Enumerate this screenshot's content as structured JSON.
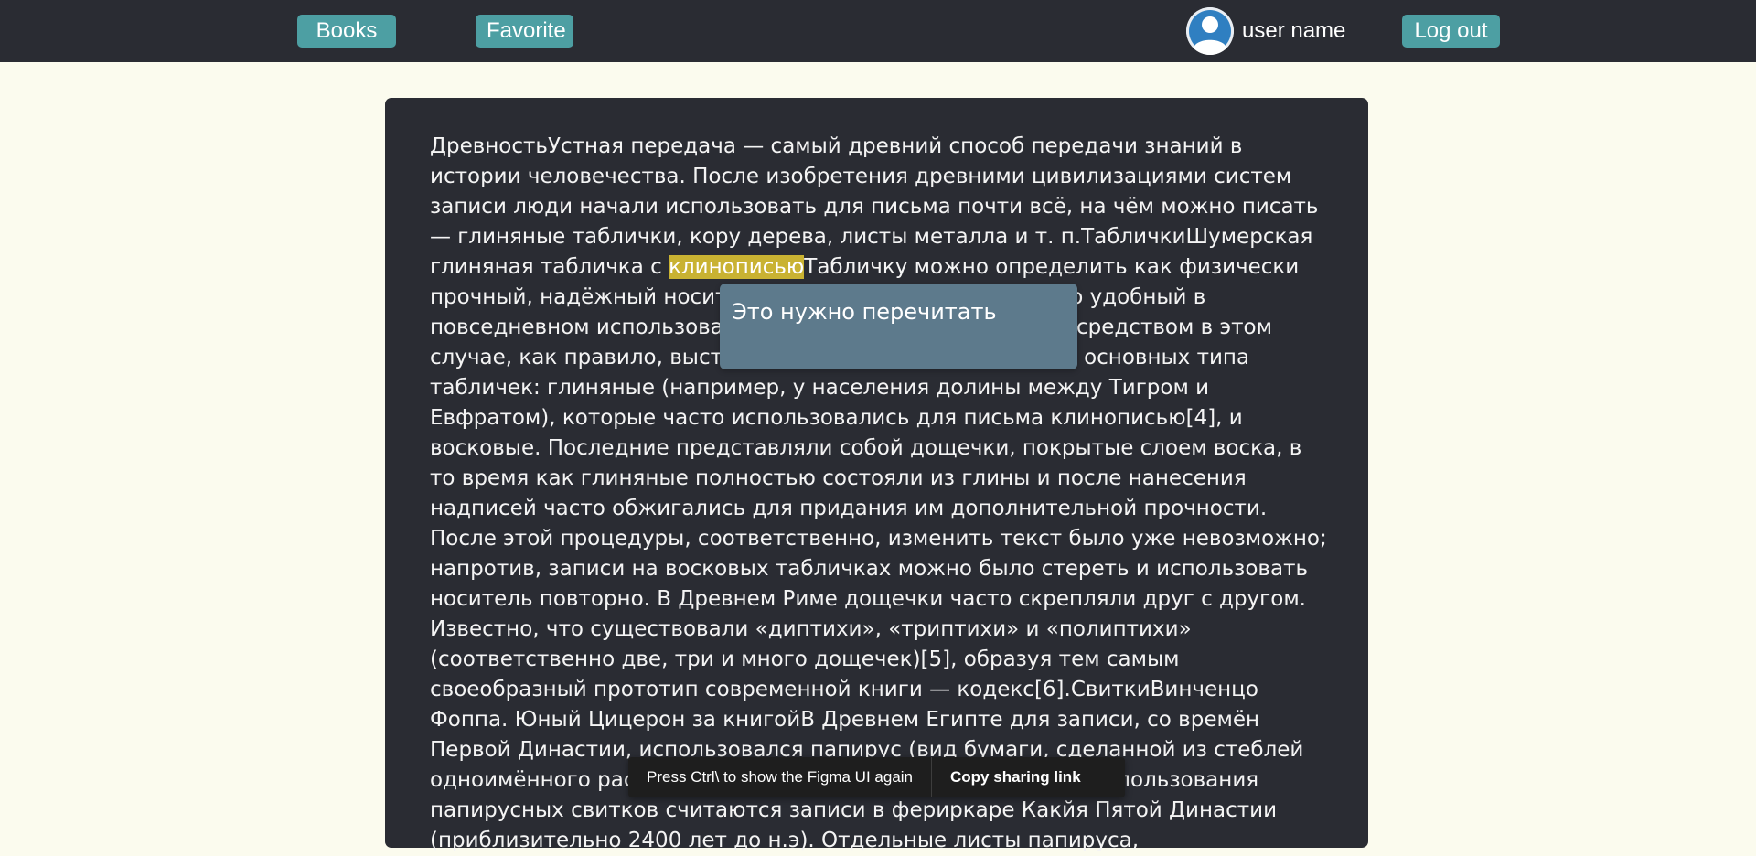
{
  "nav": {
    "books_label": "Books",
    "favorite_label": "Favorite",
    "user_name": "user name",
    "logout_label": "Log out"
  },
  "book": {
    "text_before": "ДревностьУстная передача — самый древний способ передачи знаний в истории человечества. После изобретения древними цивилизациями систем записи люди начали использовать для письма почти всё, на чём можно писать — глиняные таблички, кору дерева, листы металла и т. п.ТабличкиШумерская глиняная табличка с ",
    "highlight": "клинописью",
    "text_after": "Табличку можно определить как физически прочный, надёжный носитель информации, относительно удобный в повседневном использовании. Основным записывающим средством в этом случае, как правило, выступал стилус. Существовало два основных типа табличек: глиняные (например, у населения долины между Тигром и Евфратом), которые часто использовались для письма клинописью[4], и восковые. Последние представляли собой дощечки, покрытые слоем воска, в то время как глиняные полностью состояли из глины и после нанесения надписей часто обжигались для придания им дополнительной прочности. После этой процедуры, соответственно, изменить текст было уже невозможно; напротив, записи на восковых табличках можно было стереть и использовать носитель повторно. В Древнем Риме дощечки часто скрепляли друг с другом. Известно, что существовали «диптихи», «триптихи» и «полиптихи» (соответственно две, три и много дощечек)[5], образуя тем самым своеобразный прототип современной книги — кодекс[6].СвиткиВинченцо Фоппа. Юный Цицерон за книгойВ Древнем Египте для записи, со времён Первой Династии, использовался папирус (вид бумаги, сделанной из стеблей одноимённого растения). Однако первым свидетельством использования папирусных свитков считаются записи в фериркаре Какйя Пятой Династии (приблизительно 2400 лет до н.э). Отдельные листы папируса,"
  },
  "note": {
    "text": "Это нужно перечитать"
  },
  "figma": {
    "message": "Press Ctrl\\ to show the Figma UI again",
    "copy_label": "Copy sharing link"
  },
  "colors": {
    "page_bg": "#fbfbee",
    "topbar": "#2a2c33",
    "nav_button": "#4d9fa3",
    "panel": "#2a2c33",
    "highlight": "#c9b232",
    "note_bg": "#5d7a8c",
    "avatar_fill": "#2f7fc1"
  },
  "icons": {
    "avatar": "user-avatar-icon"
  }
}
